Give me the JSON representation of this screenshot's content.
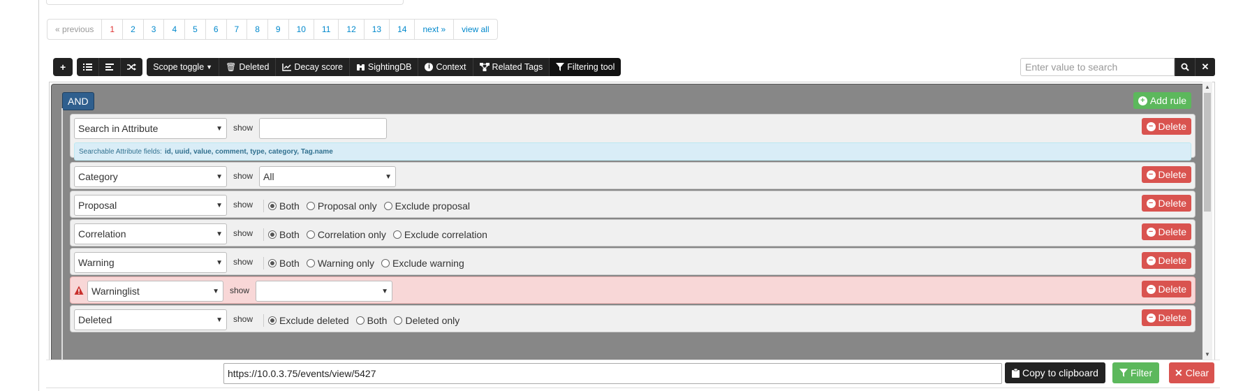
{
  "pagination": {
    "previous": "« previous",
    "pages": [
      "1",
      "2",
      "3",
      "4",
      "5",
      "6",
      "7",
      "8",
      "9",
      "10",
      "11",
      "12",
      "13",
      "14"
    ],
    "next": "next »",
    "view_all": "view all",
    "current": "1"
  },
  "toolbar": {
    "scope_toggle": "Scope toggle",
    "deleted": "Deleted",
    "decay_score": "Decay score",
    "sightingdb": "SightingDB",
    "context": "Context",
    "related_tags": "Related Tags",
    "filtering_tool": "Filtering tool"
  },
  "search": {
    "placeholder": "Enter value to search"
  },
  "query_builder": {
    "condition": "AND",
    "add_rule": "Add rule",
    "delete_label": "Delete",
    "operator_label": "show",
    "rules": [
      {
        "field": "Search in Attribute",
        "value": "",
        "info_prefix": "Searchable Attribute fields:",
        "info_fields": "id, uuid, value, comment, type, category, Tag.name"
      },
      {
        "field": "Category",
        "value": "All"
      },
      {
        "field": "Proposal",
        "options": [
          "Both",
          "Proposal only",
          "Exclude proposal"
        ],
        "selected": "Both"
      },
      {
        "field": "Correlation",
        "options": [
          "Both",
          "Correlation only",
          "Exclude correlation"
        ],
        "selected": "Both"
      },
      {
        "field": "Warning",
        "options": [
          "Both",
          "Warning only",
          "Exclude warning"
        ],
        "selected": "Both"
      },
      {
        "field": "Warninglist",
        "value": "",
        "status": "error"
      },
      {
        "field": "Deleted",
        "options": [
          "Exclude deleted",
          "Both",
          "Deleted only"
        ],
        "selected": "Exclude deleted"
      }
    ]
  },
  "bottom": {
    "url": "https://10.0.3.75/events/view/5427",
    "copy": "Copy to clipboard",
    "filter": "Filter",
    "clear": "Clear"
  },
  "colors": {
    "toolbar_bg": "#222222",
    "group_bg": "#878787",
    "and_button": "#2f5f8e",
    "success": "#5cb85c",
    "danger": "#d9534f",
    "info_bg": "#d9edf7",
    "error_rule_bg": "#f8d7d7",
    "link": "#0088cc",
    "active_page": "#e03030"
  }
}
